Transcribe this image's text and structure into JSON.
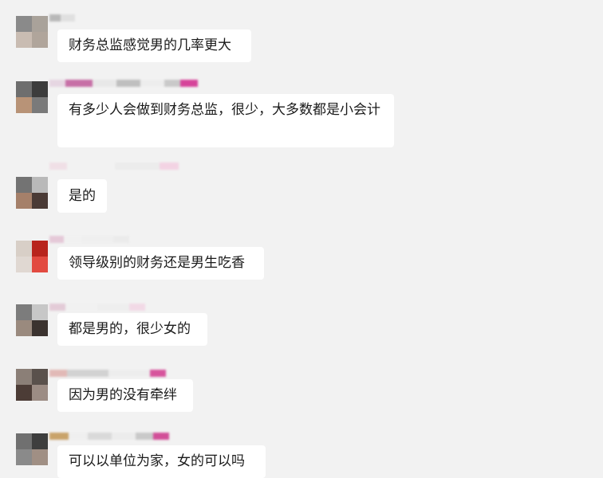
{
  "messages": [
    {
      "text": "财务总监感觉男的几率更大"
    },
    {
      "text": "有多少人会做到财务总监，很少，大多数都是小会计"
    },
    {
      "text": "是的"
    },
    {
      "text": "领导级别的财务还是男生吃香"
    },
    {
      "text": "都是男的，很少女的"
    },
    {
      "text": "因为男的没有牵绊"
    },
    {
      "text": "可以以单位为家，女的可以吗"
    }
  ]
}
